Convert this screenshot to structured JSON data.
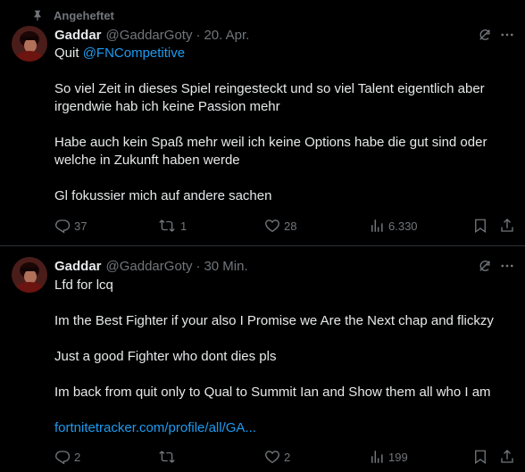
{
  "tweets": [
    {
      "pinned_label": "Angeheftet",
      "name": "Gaddar",
      "handle": "@GaddarGoty",
      "separator": "·",
      "time": "20. Apr.",
      "line1_text": "Quit ",
      "mention": "@FNCompetitive",
      "paragraphs": [
        "So viel Zeit in dieses Spiel reingesteckt  und so viel Talent eigentlich aber irgendwie hab ich keine Passion mehr",
        "Habe auch kein Spaß mehr weil ich keine Options habe die gut sind oder welche in Zukunft haben werde",
        "Gl fokussier mich auf andere sachen"
      ],
      "stats": {
        "replies": "37",
        "reposts": "1",
        "likes": "28",
        "views": "6.330"
      }
    },
    {
      "name": "Gaddar",
      "handle": "@GaddarGoty",
      "separator": "·",
      "time": "30 Min.",
      "paragraphs": [
        "Lfd for lcq",
        "Im the Best Fighter if your also I Promise we Are the Next chap and flickzy",
        "Just a good Fighter who dont dies pls",
        "Im back from quit only to Qual to Summit Ian and Show them all who I am"
      ],
      "link": "fortnitetracker.com/profile/all/GA...",
      "stats": {
        "replies": "2",
        "reposts": "",
        "likes": "2",
        "views": "199"
      }
    }
  ],
  "colors": {
    "background": "#000000",
    "text": "#e7e9ea",
    "muted": "#71767b",
    "link": "#1d9bf0",
    "divider": "#2f3336"
  },
  "icons": [
    "pin-icon",
    "grok-icon",
    "more-icon",
    "reply-icon",
    "repost-icon",
    "like-icon",
    "views-icon",
    "bookmark-icon",
    "share-icon"
  ]
}
